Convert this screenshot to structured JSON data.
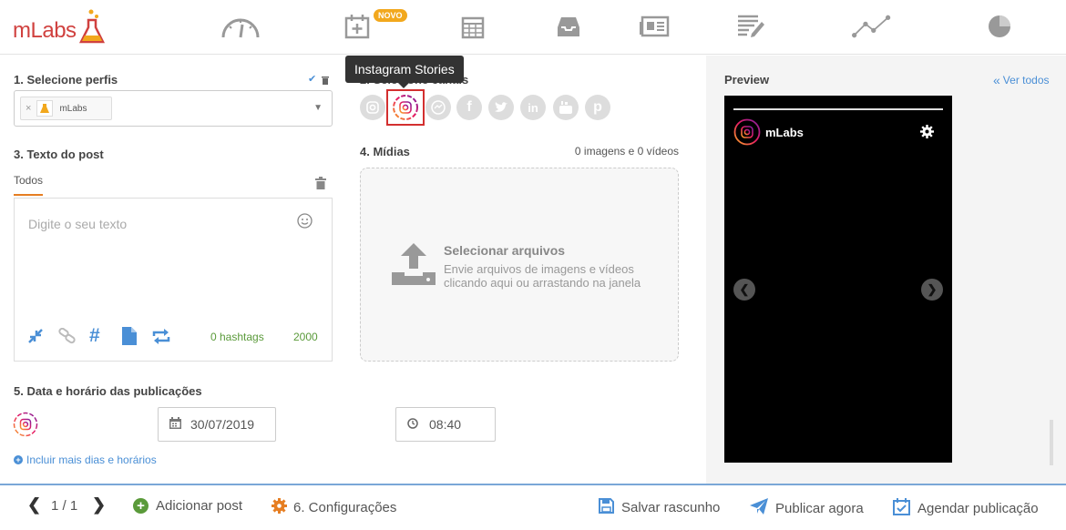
{
  "app": {
    "logo_text": "mLabs"
  },
  "nav": {
    "badge_new": "NOVO"
  },
  "section1": {
    "title": "1. Selecione perfis",
    "profile_chip": "mLabs"
  },
  "tooltip": "Instagram Stories",
  "section2": {
    "title": "2. Selecione canais"
  },
  "section3": {
    "title": "3. Texto do post",
    "tab_all": "Todos",
    "placeholder": "Digite o seu texto",
    "hashtags": "0 hashtags",
    "char_count": "2000"
  },
  "section4": {
    "title": "4. Mídias",
    "counter": "0 imagens e 0 vídeos",
    "upload_title": "Selecionar arquivos",
    "upload_line1": "Envie arquivos de imagens e vídeos",
    "upload_line2": "clicando aqui ou arrastando na janela"
  },
  "section5": {
    "title": "5. Data e horário das publicações",
    "date": "30/07/2019",
    "time": "08:40",
    "more_link": "Incluir mais dias e horários"
  },
  "preview": {
    "title": "Preview",
    "see_all": "Ver todos",
    "account_name": "mLabs"
  },
  "bottom": {
    "page_indicator": "1 / 1",
    "add_post": "Adicionar post",
    "settings": "6. Configurações",
    "save_draft": "Salvar rascunho",
    "publish_now": "Publicar agora",
    "schedule": "Agendar publicação"
  },
  "colors": {
    "accent_blue": "#4a8fd6",
    "green": "#5a9a3a",
    "orange": "#e67e22",
    "brand_red": "#d0413f",
    "highlight_red": "#d32f2f",
    "badge_orange": "#f2a81d"
  }
}
